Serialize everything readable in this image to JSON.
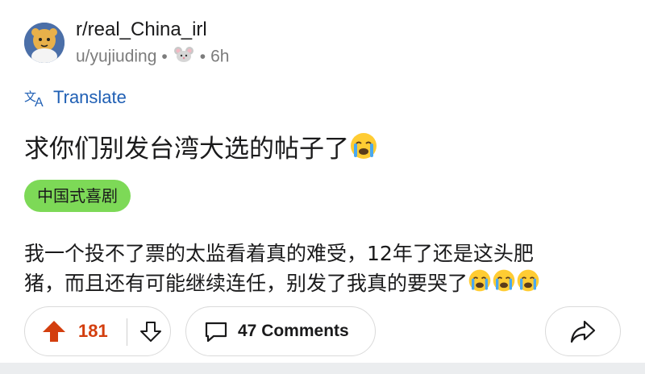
{
  "post": {
    "subreddit": "r/real_China_irl",
    "author": "u/yujiuding",
    "separator": "•",
    "time": "6h",
    "translate_label": "Translate",
    "title": "求你们别发台湾大选的帖子了",
    "flair": "中国式喜剧",
    "body_lines": [
      "我一个投不了票的太监看着真的难受，12年了还是这头肥",
      "猪，而且还有可能继续连任，别发了我真的要哭了"
    ]
  },
  "actions": {
    "upvotes": "181",
    "comments_label": "47 Comments"
  },
  "colors": {
    "upvote": "#d33e0e",
    "link": "#1f5fb4",
    "flair_bg": "#7dd957"
  },
  "icons": [
    "avatar",
    "mouse-icon",
    "translate-icon",
    "crying-emoji-icon",
    "upvote-icon",
    "downvote-icon",
    "comment-icon",
    "share-icon"
  ]
}
